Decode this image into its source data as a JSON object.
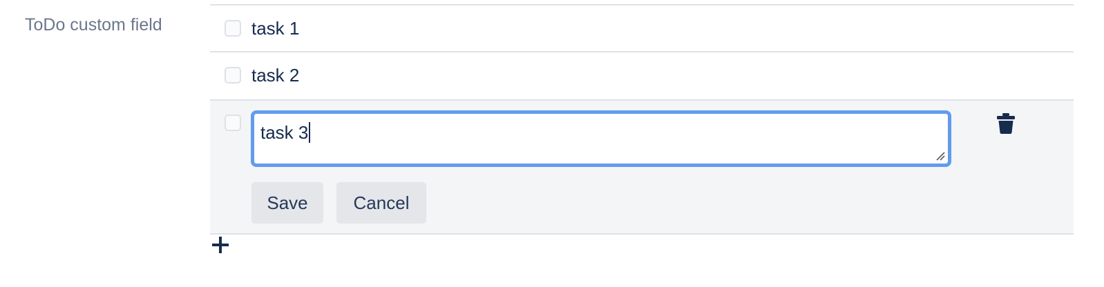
{
  "field": {
    "label": "ToDo custom field"
  },
  "todo": {
    "items": [
      {
        "text": "task 1",
        "checked": false
      },
      {
        "text": "task 2",
        "checked": false
      },
      {
        "text": "task 3",
        "checked": false,
        "editing": true
      }
    ],
    "editor": {
      "value": "task 3",
      "save_label": "Save",
      "cancel_label": "Cancel"
    },
    "icons": {
      "delete": "trash-icon",
      "add": "plus-icon"
    }
  },
  "colors": {
    "focus_ring": "#629bee",
    "text": "#172b4d",
    "label": "#6b778c",
    "edit_row_bg": "#f4f5f7",
    "button_bg": "#e4e6ea"
  }
}
